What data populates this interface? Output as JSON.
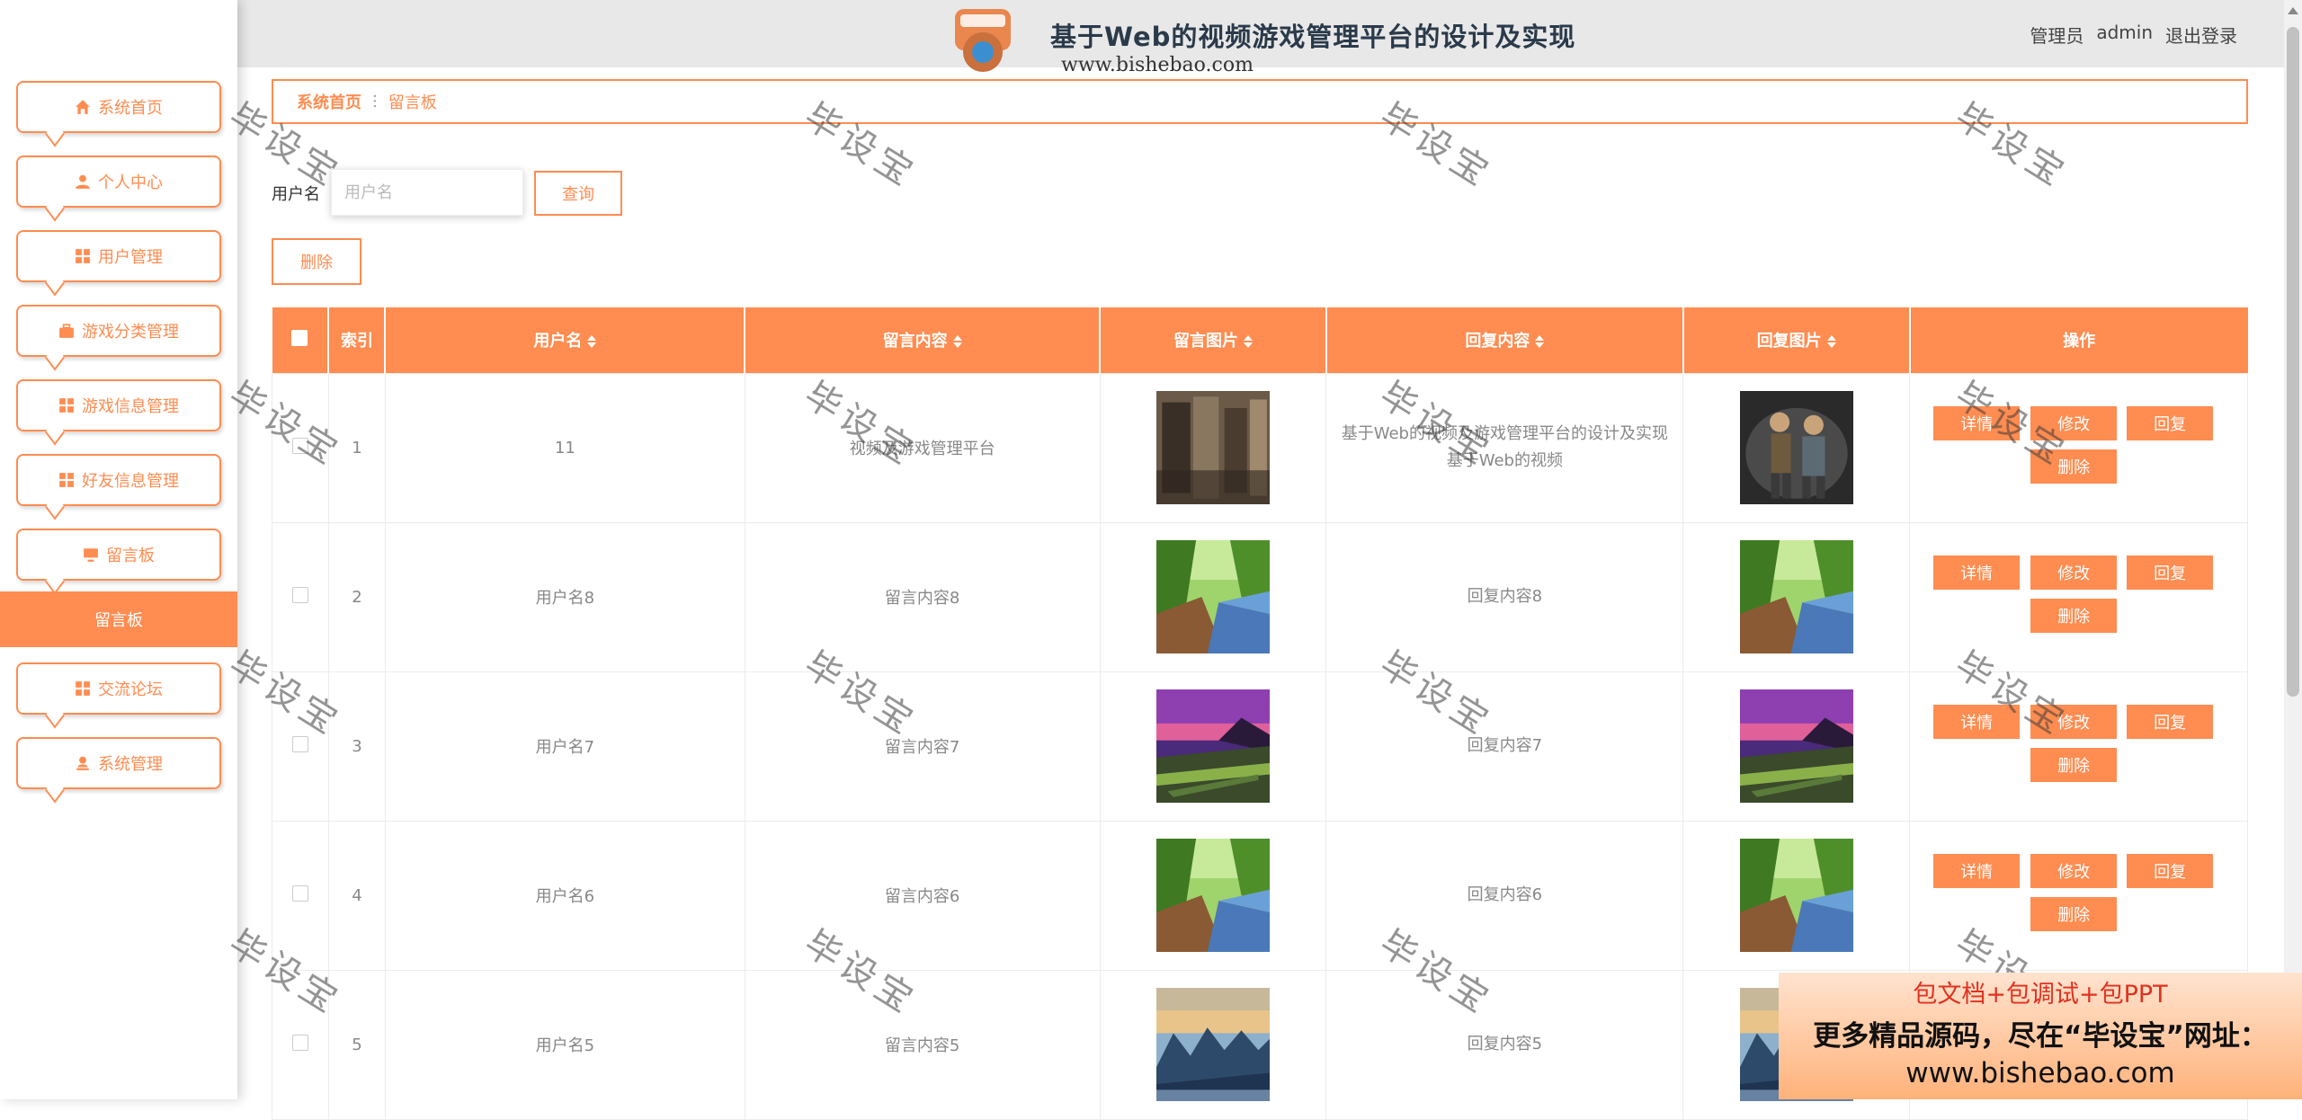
{
  "header": {
    "title": "基于Web的视频游戏管理平台的设计及实现",
    "watermark_url": "www.bishebao.com",
    "admin_role": "管理员",
    "admin_name": "admin",
    "logout": "退出登录"
  },
  "sidebar": {
    "items": [
      {
        "label": "系统首页",
        "icon": "home-icon"
      },
      {
        "label": "个人中心",
        "icon": "user-icon"
      },
      {
        "label": "用户管理",
        "icon": "grid-icon"
      },
      {
        "label": "游戏分类管理",
        "icon": "briefcase-icon"
      },
      {
        "label": "游戏信息管理",
        "icon": "grid-icon"
      },
      {
        "label": "好友信息管理",
        "icon": "grid-icon"
      },
      {
        "label": "留言板",
        "icon": "monitor-icon"
      },
      {
        "label": "交流论坛",
        "icon": "grid-icon"
      },
      {
        "label": "系统管理",
        "icon": "admin-icon"
      }
    ],
    "active_submenu": "留言板"
  },
  "breadcrumb": {
    "home": "系统首页",
    "separator": "ⵗ",
    "current": "留言板"
  },
  "search": {
    "label": "用户名",
    "placeholder": "用户名",
    "query_button": "查询",
    "delete_button": "删除"
  },
  "table": {
    "columns": [
      "索引",
      "用户名",
      "留言内容",
      "留言图片",
      "回复内容",
      "回复图片",
      "操作"
    ],
    "rows": [
      {
        "index": "1",
        "username": "11",
        "message": "视频及游戏管理平台",
        "reply": "基于Web的视频及游戏管理平台的设计及实现基于Web的视频",
        "img": "soldiers",
        "reply_img": "warriors"
      },
      {
        "index": "2",
        "username": "用户名8",
        "message": "留言内容8",
        "reply": "回复内容8",
        "img": "forest",
        "reply_img": "forest"
      },
      {
        "index": "3",
        "username": "用户名7",
        "message": "留言内容7",
        "reply": "回复内容7",
        "img": "sunset",
        "reply_img": "sunset"
      },
      {
        "index": "4",
        "username": "用户名6",
        "message": "留言内容6",
        "reply": "回复内容6",
        "img": "forest",
        "reply_img": "forest"
      },
      {
        "index": "5",
        "username": "用户名5",
        "message": "留言内容5",
        "reply": "回复内容5",
        "img": "mountains",
        "reply_img": "mountains"
      }
    ],
    "actions": {
      "detail": "详情",
      "edit": "修改",
      "reply": "回复",
      "delete": "删除"
    }
  },
  "watermark_text": "毕设宝",
  "promo": {
    "line1": "包文档+包调试+包PPT",
    "line2": "更多精品源码，尽在“毕设宝”网址：",
    "line3": "www.bishebao.com"
  },
  "colors": {
    "accent": "#ff8c50"
  }
}
